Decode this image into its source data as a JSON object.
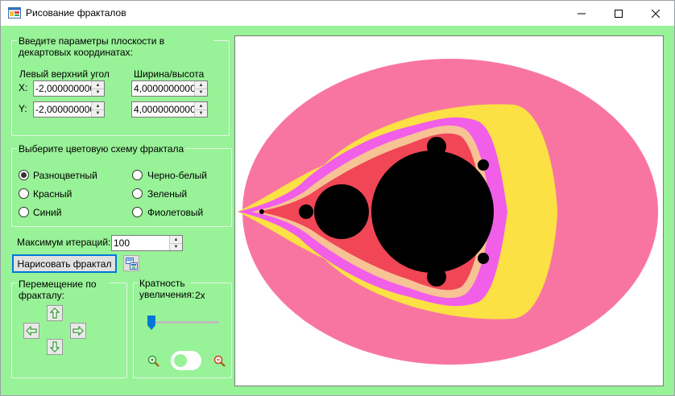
{
  "window": {
    "title": "Рисование фракталов"
  },
  "coords": {
    "group_title": "Введите параметры плоскости в декартовых координатах:",
    "left_top_label": "Левый верхний угол",
    "width_height_label": "Ширина/высота",
    "x_label": "X:",
    "y_label": "Y:",
    "x_left_top_value": "-2,0000000000",
    "y_left_top_value": "-2,0000000000",
    "x_width_value": "4,0000000000",
    "y_height_value": "4,0000000000"
  },
  "color_scheme": {
    "group_title": "Выберите цветовую схему фрактала",
    "options": [
      "Разноцветный",
      "Черно-белый",
      "Красный",
      "Зеленый",
      "Синий",
      "Фиолетовый"
    ],
    "selected": "Разноцветный"
  },
  "iterations": {
    "label": "Максимум итераций:",
    "value": "100"
  },
  "draw_button": {
    "label": "Нарисовать фрактал"
  },
  "navigation": {
    "group_title": "Перемещение по фракталу:"
  },
  "zoom": {
    "group_title": "Кратность увеличения:",
    "value": "2x",
    "slider_level": 0
  },
  "colors": {
    "window_bg": "#98f298",
    "fractal_outer": "#f875a2",
    "fractal_yellow": "#fbe144",
    "fractal_magenta": "#f15ee7",
    "fractal_peach": "#f7c294",
    "fractal_red": "#f0304a",
    "fractal_set": "#000000",
    "accent": "#0078d7"
  },
  "icons": [
    "app-icon",
    "minimize-icon",
    "maximize-icon",
    "close-icon",
    "save-icon",
    "arrow-up-icon",
    "arrow-left-icon",
    "arrow-right-icon",
    "arrow-down-icon",
    "zoom-in-icon",
    "zoom-out-icon",
    "toggle-switch"
  ]
}
